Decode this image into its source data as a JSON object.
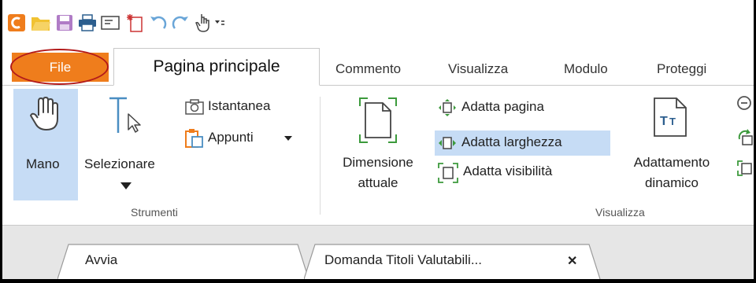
{
  "quick_access": {
    "icons": [
      "app-logo-icon",
      "open-folder-icon",
      "save-icon",
      "print-icon",
      "properties-icon",
      "new-icon",
      "undo-icon",
      "redo-icon",
      "hand-tool-icon",
      "customize-icon"
    ]
  },
  "tabs": {
    "file": "File",
    "active": "Pagina principale",
    "items": [
      "Commento",
      "Visualizza",
      "Modulo",
      "Proteggi"
    ]
  },
  "ribbon": {
    "strumenti": {
      "mano": "Mano",
      "selezionare": "Selezionare",
      "istantanea": "Istantanea",
      "appunti": "Appunti",
      "group_label": "Strumenti"
    },
    "visualizza": {
      "dimensione_line1": "Dimensione",
      "dimensione_line2": "attuale",
      "adatta_pagina": "Adatta pagina",
      "adatta_larghezza": "Adatta larghezza",
      "adatta_visibilita": "Adatta visibilità",
      "adattamento_line1": "Adattamento",
      "adattamento_line2": "dinamico",
      "group_label": "Visualizza"
    }
  },
  "document_tabs": {
    "start": "Avvia",
    "doc": "Domanda Titoli Valutabili...",
    "close_glyph": "✕"
  },
  "colors": {
    "file_tab": "#ef7d1c",
    "annotation_circle": "#b31b1b",
    "selection": "#c6dcf5",
    "icon_blue": "#4a8ec2",
    "icon_green": "#3c9a3c",
    "icon_orange": "#ef7d1c"
  }
}
